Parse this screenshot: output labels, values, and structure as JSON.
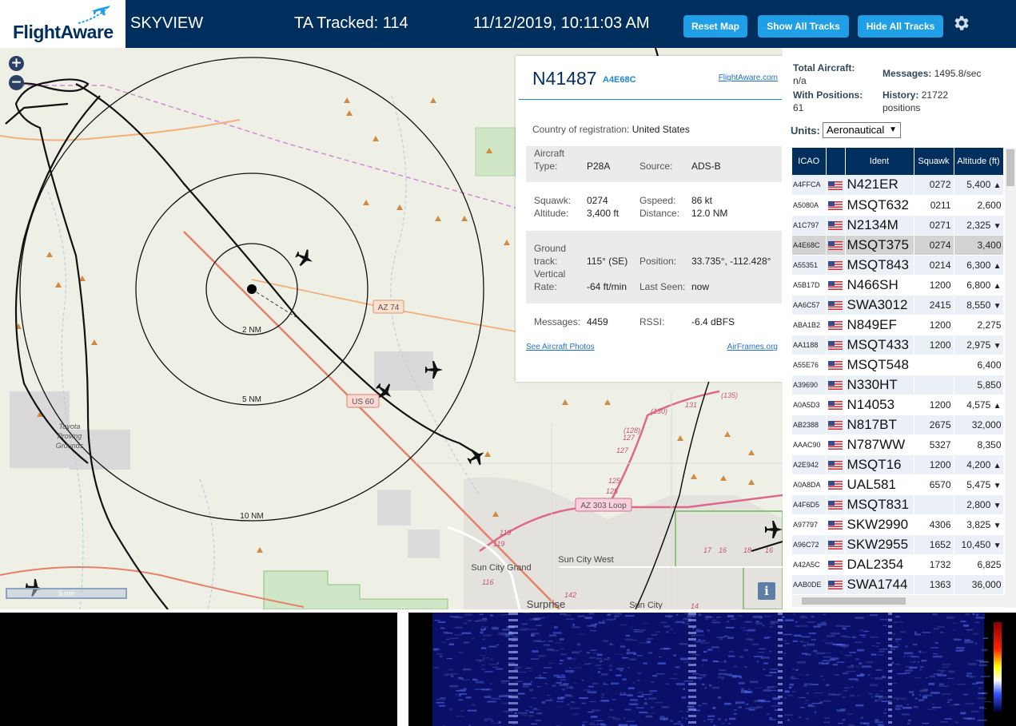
{
  "header": {
    "logo_text": "FlightAware",
    "app_title": "SKYVIEW",
    "tracked": "TA Tracked: 114",
    "datetime": "11/12/2019, 10:11:03 AM",
    "buttons": {
      "reset_map": "Reset Map",
      "show_all_tracks": "Show All Tracks",
      "hide_all_tracks": "Hide All Tracks"
    },
    "settings_icon": "gear-icon"
  },
  "map": {
    "zoom_in": "+",
    "zoom_out": "−",
    "scale_label": "5 nm",
    "info_button": "i",
    "range_rings": [
      "2 NM",
      "5 NM",
      "10 NM"
    ],
    "road_labels": [
      "AZ 74",
      "US 60",
      "AZ 303 Loop"
    ],
    "place_labels": [
      "Toyota Proving Grounds",
      "Sun City Grand",
      "Sun City West",
      "Surprise",
      "Sun City"
    ],
    "route_numbers": [
      "(130)",
      "131",
      "(135)",
      "(128)",
      "127",
      "127",
      "125",
      "125",
      "119",
      "119",
      "116",
      "142",
      "14",
      "17",
      "16",
      "18",
      "16"
    ]
  },
  "info_panel": {
    "registration": "N41487",
    "hex": "A4E68C",
    "flightaware_link": "FlightAware.com",
    "country_label": "Country of registration:",
    "country_value": "United States",
    "aircraft_type_label_1": "Aircraft",
    "aircraft_type_label_2": "Type:",
    "aircraft_type_value": "P28A",
    "source_label": "Source:",
    "source_value": "ADS-B",
    "squawk_label": "Squawk:",
    "squawk_value": "0274",
    "gspeed_label": "Gspeed:",
    "gspeed_value": "86 kt",
    "altitude_label": "Altitude:",
    "altitude_value": "3,400 ft",
    "distance_label": "Distance:",
    "distance_value": "12.0 NM",
    "ground_track_label_1": "Ground",
    "ground_track_label_2": "track:",
    "ground_track_value": "115° (SE)",
    "position_label": "Position:",
    "position_value": "33.735°, -112.428°",
    "vertical_rate_label_1": "Vertical",
    "vertical_rate_label_2": "Rate:",
    "vertical_rate_value": "-64 ft/min",
    "last_seen_label": "Last Seen:",
    "last_seen_value": "now",
    "messages_label": "Messages:",
    "messages_value": "4459",
    "rssi_label": "RSSI:",
    "rssi_value": "-6.4 dBFS",
    "photos_link": "See Aircraft Photos",
    "airframes_link": "AirFrames.org"
  },
  "side_panel": {
    "total_aircraft_label": "Total Aircraft:",
    "total_aircraft_value": "n/a",
    "messages_label": "Messages:",
    "messages_value": "1495.8/sec",
    "with_positions_label": "With Positions:",
    "with_positions_value": "61",
    "history_label": "History:",
    "history_value": "21722",
    "history_unit": "positions",
    "units_label": "Units:",
    "units_value": "Aeronautical",
    "table": {
      "headers": [
        "ICAO",
        "",
        "Ident",
        "Squawk",
        "Altitude (ft)"
      ],
      "rows": [
        {
          "icao": "A4FFCA",
          "ident": "N421ER",
          "squawk": "0272",
          "alt": "5,400",
          "trend": "▲"
        },
        {
          "icao": "A5080A",
          "ident": "MSQT632",
          "squawk": "0211",
          "alt": "2,600",
          "trend": ""
        },
        {
          "icao": "A1C797",
          "ident": "N2134M",
          "squawk": "0271",
          "alt": "2,325",
          "trend": "▼"
        },
        {
          "icao": "A4E68C",
          "ident": "MSQT375",
          "squawk": "0274",
          "alt": "3,400",
          "trend": ""
        },
        {
          "icao": "A55351",
          "ident": "MSQT843",
          "squawk": "0214",
          "alt": "6,300",
          "trend": "▲"
        },
        {
          "icao": "A5B17D",
          "ident": "N466SH",
          "squawk": "1200",
          "alt": "6,800",
          "trend": "▲"
        },
        {
          "icao": "AA6C57",
          "ident": "SWA3012",
          "squawk": "2415",
          "alt": "8,550",
          "trend": "▼"
        },
        {
          "icao": "ABA1B2",
          "ident": "N849EF",
          "squawk": "1200",
          "alt": "2,275",
          "trend": ""
        },
        {
          "icao": "AA1188",
          "ident": "MSQT433",
          "squawk": "1200",
          "alt": "2,975",
          "trend": "▼"
        },
        {
          "icao": "A55E76",
          "ident": "MSQT548",
          "squawk": "",
          "alt": "6,400",
          "trend": ""
        },
        {
          "icao": "A39690",
          "ident": "N330HT",
          "squawk": "",
          "alt": "5,850",
          "trend": ""
        },
        {
          "icao": "A0A5D3",
          "ident": "N14053",
          "squawk": "1200",
          "alt": "4,575",
          "trend": "▲"
        },
        {
          "icao": "AB2388",
          "ident": "N817BT",
          "squawk": "2675",
          "alt": "32,000",
          "trend": ""
        },
        {
          "icao": "AAAC90",
          "ident": "N787WW",
          "squawk": "5327",
          "alt": "8,350",
          "trend": ""
        },
        {
          "icao": "A2E942",
          "ident": "MSQT16",
          "squawk": "1200",
          "alt": "4,200",
          "trend": "▲"
        },
        {
          "icao": "A0A8DA",
          "ident": "UAL581",
          "squawk": "6570",
          "alt": "5,475",
          "trend": "▼"
        },
        {
          "icao": "A4F6D5",
          "ident": "MSQT831",
          "squawk": "",
          "alt": "2,800",
          "trend": "▼"
        },
        {
          "icao": "A97797",
          "ident": "SKW2990",
          "squawk": "4306",
          "alt": "3,825",
          "trend": "▼"
        },
        {
          "icao": "A96C72",
          "ident": "SKW2955",
          "squawk": "1652",
          "alt": "10,450",
          "trend": "▼"
        },
        {
          "icao": "A42A5C",
          "ident": "DAL2354",
          "squawk": "1732",
          "alt": "6,825",
          "trend": ""
        },
        {
          "icao": "AAB0DE",
          "ident": "SWA1744",
          "squawk": "1363",
          "alt": "36,000",
          "trend": ""
        }
      ]
    }
  },
  "colors": {
    "header_bg": "#002f5d",
    "button_bg": "#1f9fe6",
    "link": "#1f6fd0",
    "selected_row": "#d3d3d3"
  }
}
